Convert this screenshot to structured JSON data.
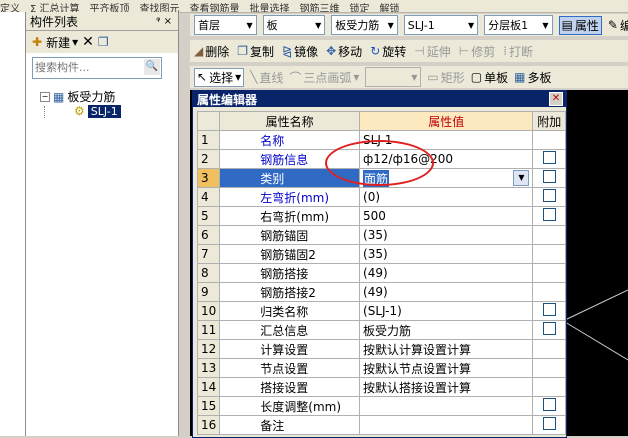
{
  "top_strip": [
    "定义",
    "Σ 汇总计算",
    "平齐板顶",
    "查找图元",
    "查看钢筋量",
    "批量选择",
    "钢筋三维",
    "锁定",
    "解锁"
  ],
  "component_list": {
    "title": "构件列表",
    "pin": "ᵠ ×",
    "new_label": "新建",
    "search_placeholder": "搜索构件...",
    "tree_root": "板受力筋",
    "tree_child": "SLJ-1"
  },
  "toolbar1": {
    "floor": "首层",
    "category": "板",
    "type": "板受力筋",
    "item": "SLJ-1",
    "layer": "分层板1",
    "property": "属性",
    "edit": "编"
  },
  "toolbar2": [
    "删除",
    "复制",
    "镜像",
    "移动",
    "旋转",
    "延伸",
    "修剪",
    "打断"
  ],
  "toolbar3": {
    "select": "选择",
    "line": "直线",
    "arc": "三点画弧",
    "rect": "矩形",
    "single": "单板",
    "multi": "多板"
  },
  "dialog": {
    "title": "属性编辑器",
    "headers": {
      "name": "属性名称",
      "value": "属性值",
      "extra": "附加"
    },
    "rows": [
      {
        "num": "1",
        "name": "名称",
        "value": "SLJ-1",
        "blue": true,
        "check": false
      },
      {
        "num": "2",
        "name": "钢筋信息",
        "value": "ф12/ф16@200",
        "blue": true,
        "check": true
      },
      {
        "num": "3",
        "name": "类别",
        "value": "面筋",
        "blue": false,
        "check": true
      },
      {
        "num": "4",
        "name": "左弯折(mm)",
        "value": "(0)",
        "blue": true,
        "check": true
      },
      {
        "num": "5",
        "name": "右弯折(mm)",
        "value": "500",
        "blue": false,
        "check": true
      },
      {
        "num": "6",
        "name": "钢筋锚固",
        "value": "(35)",
        "blue": false,
        "check": false
      },
      {
        "num": "7",
        "name": "钢筋锚固2",
        "value": "(35)",
        "blue": false,
        "check": false
      },
      {
        "num": "8",
        "name": "钢筋搭接",
        "value": "(49)",
        "blue": false,
        "check": false
      },
      {
        "num": "9",
        "name": "钢筋搭接2",
        "value": "(49)",
        "blue": false,
        "check": false
      },
      {
        "num": "10",
        "name": "归类名称",
        "value": "(SLJ-1)",
        "blue": false,
        "check": true
      },
      {
        "num": "11",
        "name": "汇总信息",
        "value": "板受力筋",
        "blue": false,
        "check": true
      },
      {
        "num": "12",
        "name": "计算设置",
        "value": "按默认计算设置计算",
        "blue": false,
        "check": false
      },
      {
        "num": "13",
        "name": "节点设置",
        "value": "按默认节点设置计算",
        "blue": false,
        "check": false
      },
      {
        "num": "14",
        "name": "搭接设置",
        "value": "按默认搭接设置计算",
        "blue": false,
        "check": false
      },
      {
        "num": "15",
        "name": "长度调整(mm)",
        "value": "",
        "blue": false,
        "check": true
      },
      {
        "num": "16",
        "name": "备注",
        "value": "",
        "blue": false,
        "check": true
      }
    ]
  }
}
